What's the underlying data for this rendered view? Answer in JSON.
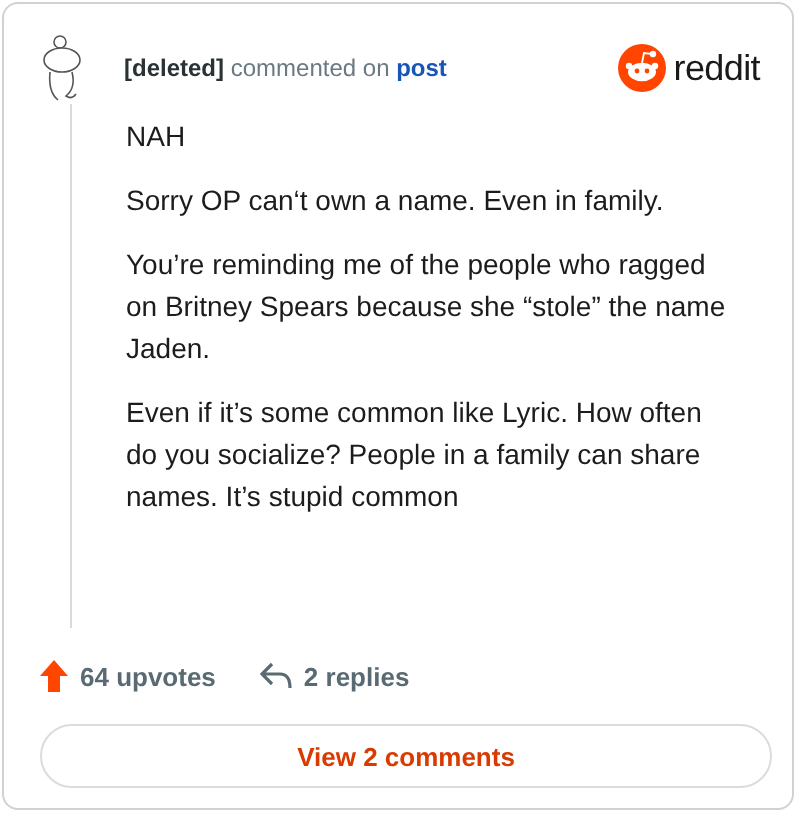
{
  "header": {
    "author": "[deleted]",
    "action": "commented on",
    "target": "post",
    "brand": "reddit"
  },
  "paragraphs": [
    "NAH",
    "Sorry OP can‘t own a name. Even in family.",
    "You’re reminding me of the people who ragged on Britney Spears because she “stole” the name Jaden.",
    "Even if it’s some common like Lyric. How often do you socialize? People in a family can share names. It’s stupid common"
  ],
  "footer": {
    "upvotes": "64 upvotes",
    "replies": "2 replies"
  },
  "button": "View 2 comments"
}
